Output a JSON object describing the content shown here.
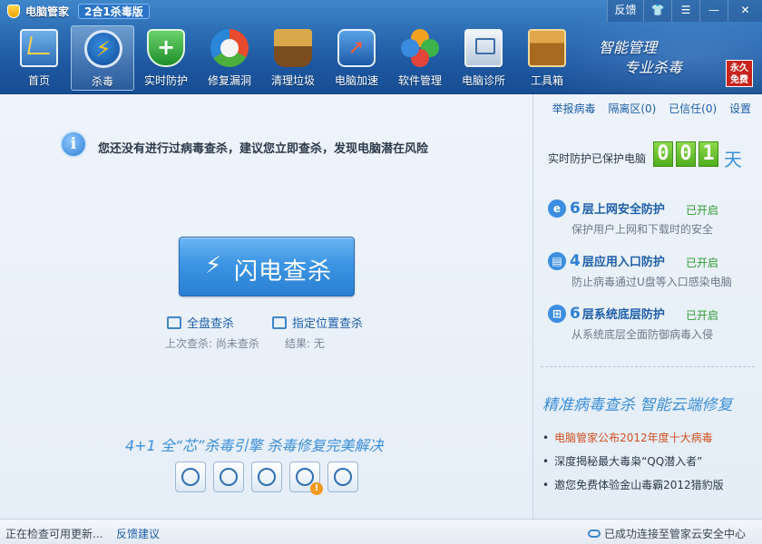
{
  "window": {
    "title": "电脑管家",
    "edition": "2合1杀毒版",
    "controls": {
      "feedback": "反馈",
      "shirt": "👕",
      "menu": "☰",
      "minimize": "—",
      "close": "✕"
    }
  },
  "nav": [
    {
      "label": "首页",
      "icon": "monitor-icon"
    },
    {
      "label": "杀毒",
      "icon": "lightning-icon",
      "active": true
    },
    {
      "label": "实时防护",
      "icon": "shield-icon"
    },
    {
      "label": "修复漏洞",
      "icon": "repair-icon"
    },
    {
      "label": "清理垃圾",
      "icon": "broom-icon"
    },
    {
      "label": "电脑加速",
      "icon": "rocket-icon"
    },
    {
      "label": "软件管理",
      "icon": "clover-icon"
    },
    {
      "label": "电脑诊所",
      "icon": "stethoscope-icon"
    },
    {
      "label": "工具箱",
      "icon": "toolbox-icon"
    }
  ],
  "slogan": {
    "line1": "智能管理",
    "line2": "专业杀毒",
    "badge": "永久免费"
  },
  "main": {
    "notice": "您还没有进行过病毒查杀，建议您立即查杀，发现电脑潜在风险",
    "scan_button": "闪电查杀",
    "full_scan": "全盘查杀",
    "custom_scan": "指定位置查杀",
    "last_scan": "上次查杀: 尚未查杀",
    "result": "结果: 无",
    "engine_text": "4+1 全“芯”杀毒引擎    杀毒修复完美解决"
  },
  "right": {
    "links": [
      "举报病毒",
      "隔离区(0)",
      "已信任(0)",
      "设置"
    ],
    "protect_label": "实时防护已保护电脑",
    "days_digits": [
      "0",
      "0",
      "1"
    ],
    "days_unit": "天",
    "layers": [
      {
        "num": "6",
        "title": "层上网安全防护",
        "status": "已开启",
        "desc": "保护用户上网和下载时的安全",
        "icon": "e"
      },
      {
        "num": "4",
        "title": "层应用入口防护",
        "status": "已开启",
        "desc": "防止病毒通过U盘等入口感染电脑",
        "icon": "▤"
      },
      {
        "num": "6",
        "title": "层系统底层防护",
        "status": "已开启",
        "desc": "从系统底层全面防御病毒入侵",
        "icon": "⊞"
      }
    ],
    "promo_title": "精准病毒查杀   智能云端修复",
    "news": [
      {
        "text": "电脑管家公布2012年度十大病毒",
        "hot": true
      },
      {
        "text": "深度揭秘最大毒枭“QQ潜入者”",
        "hot": false
      },
      {
        "text": "邀您免费体验金山毒霸2012猎豹版",
        "hot": false
      }
    ]
  },
  "status_bar": {
    "left": "正在检查可用更新...",
    "feedback": "反馈建议",
    "cloud": "已成功连接至管家云安全中心"
  },
  "colors": {
    "accent": "#2f7fd3",
    "status_on": "#2e9a2e",
    "hot_news": "#d0501e",
    "days_green": "#5ab82a"
  }
}
